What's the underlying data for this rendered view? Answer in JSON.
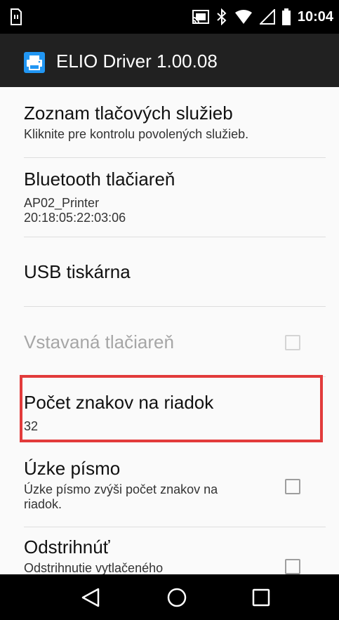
{
  "status_bar": {
    "time": "10:04",
    "icons": [
      "sim-card-icon",
      "cast-icon",
      "bluetooth-icon",
      "wifi-icon",
      "signal-icon",
      "battery-icon"
    ]
  },
  "app_bar": {
    "icon": "printer-icon",
    "title": "ELIO Driver 1.00.08"
  },
  "preferences": [
    {
      "key": "print-services",
      "title": "Zoznam tlačových služieb",
      "summary": "Kliknite pre kontrolu povolených služieb."
    },
    {
      "key": "bluetooth-printer",
      "title": "Bluetooth tlačiareň",
      "summary_lines": [
        "AP02_Printer",
        "20:18:05:22:03:06"
      ]
    },
    {
      "key": "usb-printer",
      "title": "USB tiskárna"
    },
    {
      "key": "builtin-printer",
      "title": "Vstavaná tlačiareň",
      "enabled": false,
      "checked": false
    },
    {
      "key": "chars-per-line",
      "title": "Počet znakov na riadok",
      "summary": "32",
      "highlighted": true
    },
    {
      "key": "narrow-font",
      "title": "Úzke písmo",
      "summary": "Úzke písmo zvýši počet znakov na riadok.",
      "checked": false
    },
    {
      "key": "cut",
      "title": "Odstrihnúť",
      "summary": "Odstrihnutie vytlačeného",
      "checked": false
    }
  ],
  "colors": {
    "app_bar": "#212121",
    "highlight_border": "#e23b3b",
    "disabled_text": "#a6a6a6",
    "app_icon": "#2196f3"
  },
  "nav_bar": {
    "buttons": [
      "back-icon",
      "home-icon",
      "recents-icon"
    ]
  }
}
